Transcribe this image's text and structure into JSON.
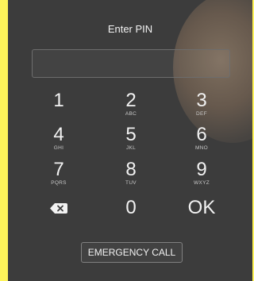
{
  "title": "Enter PIN",
  "pin_field": {
    "value": ""
  },
  "keys": [
    {
      "num": "1",
      "sub": ""
    },
    {
      "num": "2",
      "sub": "ABC"
    },
    {
      "num": "3",
      "sub": "DEF"
    },
    {
      "num": "4",
      "sub": "GHI"
    },
    {
      "num": "5",
      "sub": "JKL"
    },
    {
      "num": "6",
      "sub": "MNO"
    },
    {
      "num": "7",
      "sub": "PQRS"
    },
    {
      "num": "8",
      "sub": "TUV"
    },
    {
      "num": "9",
      "sub": "WXYZ"
    },
    {
      "num": "0",
      "sub": ""
    }
  ],
  "delete_icon": "backspace-icon",
  "ok_label": "OK",
  "emergency_label": "EMERGENCY CALL",
  "colors": {
    "frame": "#fdf35a",
    "screen": "#3c3c3c",
    "text": "#f2f2f2"
  }
}
